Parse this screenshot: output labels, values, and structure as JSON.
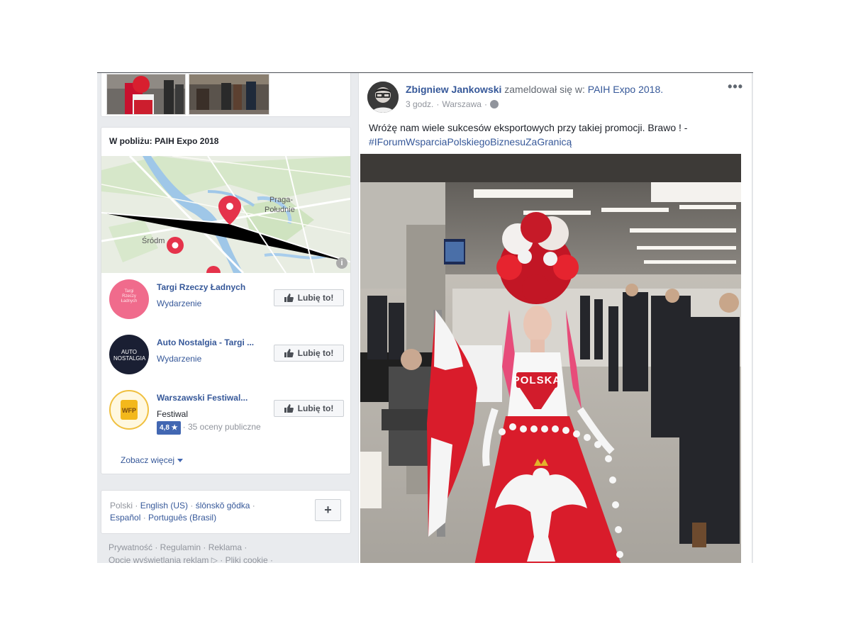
{
  "nearby": {
    "title": "W pobliżu: PAIH Expo 2018",
    "map_labels": {
      "praga": "Praga-",
      "poludnie": "Południe",
      "srodm": "Śródm"
    },
    "places": [
      {
        "name": "Targi Rzeczy Ładnych",
        "type": "Wydarzenie",
        "logo_text": "Targi Rzeczy Ładnych",
        "like_label": "Lubię to!"
      },
      {
        "name": "Auto Nostalgia - Targi ...",
        "type": "Wydarzenie",
        "logo_text": "AUTO NOSTALGIA",
        "like_label": "Lubię to!"
      },
      {
        "name": "Warszawski Festiwal...",
        "type": "Festiwal",
        "logo_text": "WFP",
        "like_label": "Lubię to!",
        "rating_value": "4,8 ★",
        "rating_text": "· 35 oceny publiczne"
      }
    ],
    "see_more": "Zobacz więcej"
  },
  "languages": {
    "current": "Polski",
    "others": [
      "English (US)",
      "ślōnskŏ gŏdka",
      "Español",
      "Português (Brasil)"
    ],
    "plus": "+"
  },
  "footer": {
    "line1": "Prywatność · Regulamin · Reklama ·",
    "line2": "Opcje wyświetlania reklam ▷ · Pliki cookie ·"
  },
  "post": {
    "author": "Zbigniew Jankowski",
    "action": "zameldował się w:",
    "place": "PAIH Expo 2018.",
    "time": "3 godz.",
    "location": "Warszawa",
    "more": "•••",
    "text": "Wróżę nam wiele sukcesów eksportowych przy takiej promocji. Brawo ! -",
    "hashtag": "#IForumWsparciaPolskiegoBiznesuZaGranicą",
    "photo_text": "POLSKA"
  },
  "colors": {
    "link": "#365899",
    "accent": "#4267b2",
    "map_pin": "#e5334b",
    "flag_red": "#d91c2b"
  }
}
